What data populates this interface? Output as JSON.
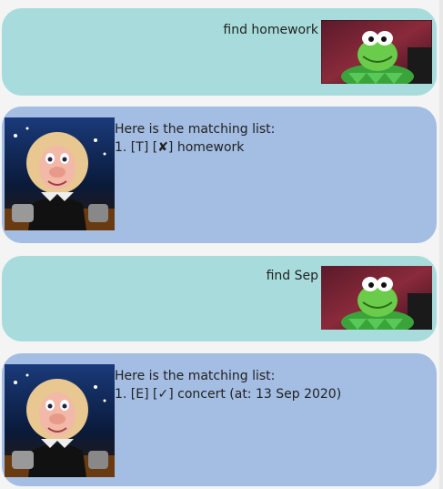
{
  "messages": [
    {
      "role": "user",
      "text": "find homework",
      "avatar": "kermit-avatar"
    },
    {
      "role": "bot",
      "lines": [
        "Here is the matching list:",
        "1. [T] [✘] homework"
      ],
      "avatar": "piggy-avatar"
    },
    {
      "role": "user",
      "text": "find Sep",
      "avatar": "kermit-avatar"
    },
    {
      "role": "bot",
      "lines": [
        "Here is the matching list:",
        "1. [E] [✓] concert (at: 13 Sep 2020)"
      ],
      "avatar": "piggy-avatar"
    }
  ],
  "colors": {
    "user_bubble": "#a8dcdc",
    "bot_bubble": "#a3bde3"
  }
}
